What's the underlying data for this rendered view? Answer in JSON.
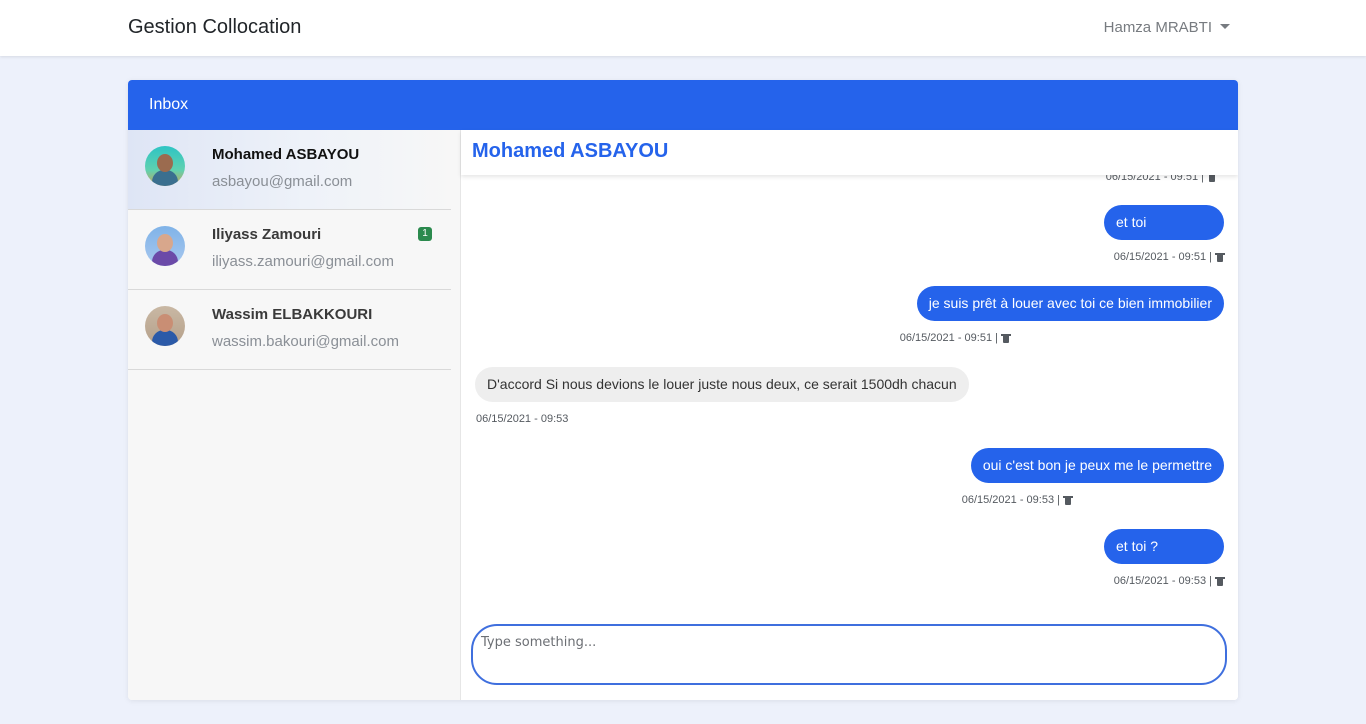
{
  "navbar": {
    "brand": "Gestion Collocation",
    "user_name": "Hamza MRABTI"
  },
  "inbox": {
    "title": "Inbox"
  },
  "contacts": [
    {
      "name": "Mohamed ASBAYOU",
      "email": "asbayou@gmail.com",
      "badge": null,
      "active": true
    },
    {
      "name": "Iliyass Zamouri",
      "email": "iliyass.zamouri@gmail.com",
      "badge": "1",
      "active": false
    },
    {
      "name": "Wassim ELBAKKOURI",
      "email": "wassim.bakouri@gmail.com",
      "badge": null,
      "active": false
    }
  ],
  "chat": {
    "title": "Mohamed ASBAYOU",
    "messages": [
      {
        "direction": "sent",
        "text": "",
        "meta": "06/15/2021 - 09:51 |"
      },
      {
        "direction": "sent",
        "text": "et toi",
        "meta": "06/15/2021 - 09:51 |"
      },
      {
        "direction": "sent",
        "text": "je suis prêt à louer avec toi ce bien immobilier",
        "meta": "06/15/2021 - 09:51 |"
      },
      {
        "direction": "received",
        "text": "D'accord Si nous devions le louer juste nous deux, ce serait 1500dh chacun",
        "meta": "06/15/2021 - 09:53"
      },
      {
        "direction": "sent",
        "text": "oui c'est bon je peux me le permettre",
        "meta": "06/15/2021 - 09:53 |"
      },
      {
        "direction": "sent",
        "text": "et toi ?",
        "meta": "06/15/2021 - 09:53 |"
      }
    ],
    "input_placeholder": "Type something...",
    "input_value": ""
  },
  "icons": {
    "dropdown": "caret-down-icon",
    "delete": "trash-icon"
  },
  "colors": {
    "accent": "#2563eb",
    "badge": "#2b8a4e",
    "background": "#edf1fb"
  }
}
